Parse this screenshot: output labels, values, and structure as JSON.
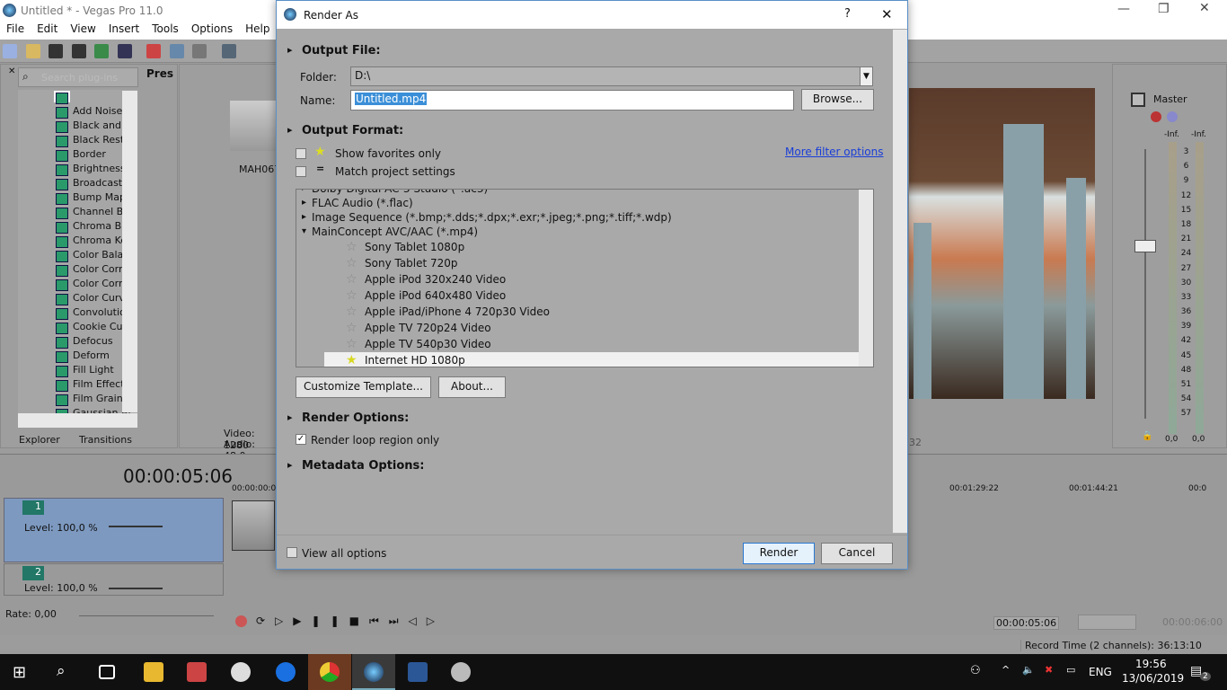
{
  "app": {
    "title": "Untitled * - Vegas Pro 11.0",
    "menu": [
      "File",
      "Edit",
      "View",
      "Insert",
      "Tools",
      "Options",
      "Help"
    ]
  },
  "explorer": {
    "search_placeholder": "Search plug-ins",
    "root": "All",
    "items": [
      "Add Noise",
      "Black and W",
      "Black Resto",
      "Border",
      "Brightness a",
      "Broadcast C",
      "Bump Map",
      "Channel Ble",
      "Chroma Blu",
      "Chroma Key",
      "Color Balan",
      "Color Corre",
      "Color Corre",
      "Color Curve",
      "Convolution",
      "Cookie Cutt",
      "Defocus",
      "Deform",
      "Fill Light",
      "Film Effects",
      "Film Grain",
      "Gaussian Bl"
    ],
    "presets_header": "Pres",
    "tabs": [
      "Explorer",
      "Transitions"
    ]
  },
  "media": {
    "clip_name": "MAH067",
    "video_info": "Video: 1280",
    "audio_info": "Audio: 48.0"
  },
  "timeline": {
    "time": "00:00:05:06",
    "ruler_start": "00:00:00:0",
    "ruler": [
      "00:01:29:22",
      "00:01:44:21",
      "00:0"
    ],
    "tracks": [
      {
        "num": "1",
        "level": "Level: 100,0 %"
      },
      {
        "num": "2",
        "level": "Level: 100,0 %"
      }
    ],
    "rate": "Rate: 0,00"
  },
  "transport": {
    "cursor_time": "00:00:05:06",
    "end_time": "00:00:06:00",
    "record_time": "Record Time (2 channels): 36:13:10"
  },
  "preview": {
    "frame_label": "32"
  },
  "master": {
    "label": "Master",
    "left_peak": "-Inf.",
    "right_peak": "-Inf.",
    "scale": [
      "3",
      "6",
      "9",
      "12",
      "15",
      "18",
      "21",
      "24",
      "27",
      "30",
      "33",
      "36",
      "39",
      "42",
      "45",
      "48",
      "51",
      "54",
      "57"
    ],
    "left_value": "0,0",
    "right_value": "0,0"
  },
  "dialog": {
    "title": "Render As",
    "help": "?",
    "close": "✕",
    "output_file": "Output File:",
    "folder_label": "Folder:",
    "folder_value": "D:\\",
    "name_label": "Name:",
    "name_value": "Untitled.mp4",
    "browse": "Browse...",
    "output_format": "Output Format:",
    "show_favorites": "Show favorites only",
    "match_project": "Match project settings",
    "more_filter": "More filter options",
    "formats": [
      {
        "label": "Dolby Digital AC-3 Studio (*.ac3)",
        "type": "grp"
      },
      {
        "label": "FLAC Audio (*.flac)",
        "type": "grp"
      },
      {
        "label": "Image Sequence (*.bmp;*.dds;*.dpx;*.exr;*.jpeg;*.png;*.tiff;*.wdp)",
        "type": "grp"
      },
      {
        "label": "MainConcept AVC/AAC (*.mp4)",
        "type": "open"
      }
    ],
    "presets": [
      "Sony Tablet 1080p",
      "Sony Tablet 720p",
      "Apple iPod 320x240 Video",
      "Apple iPod 640x480 Video",
      "Apple iPad/iPhone 4 720p30 Video",
      "Apple TV 720p24 Video",
      "Apple TV 540p30 Video",
      "Internet HD 1080p"
    ],
    "customize": "Customize Template...",
    "about": "About...",
    "render_options": "Render Options:",
    "render_loop": "Render loop region only",
    "metadata_options": "Metadata Options:",
    "view_all": "View all options",
    "render": "Render",
    "cancel": "Cancel"
  },
  "taskbar": {
    "lang": "ENG",
    "time": "19:56",
    "date": "13/06/2019",
    "notifications": "2"
  }
}
